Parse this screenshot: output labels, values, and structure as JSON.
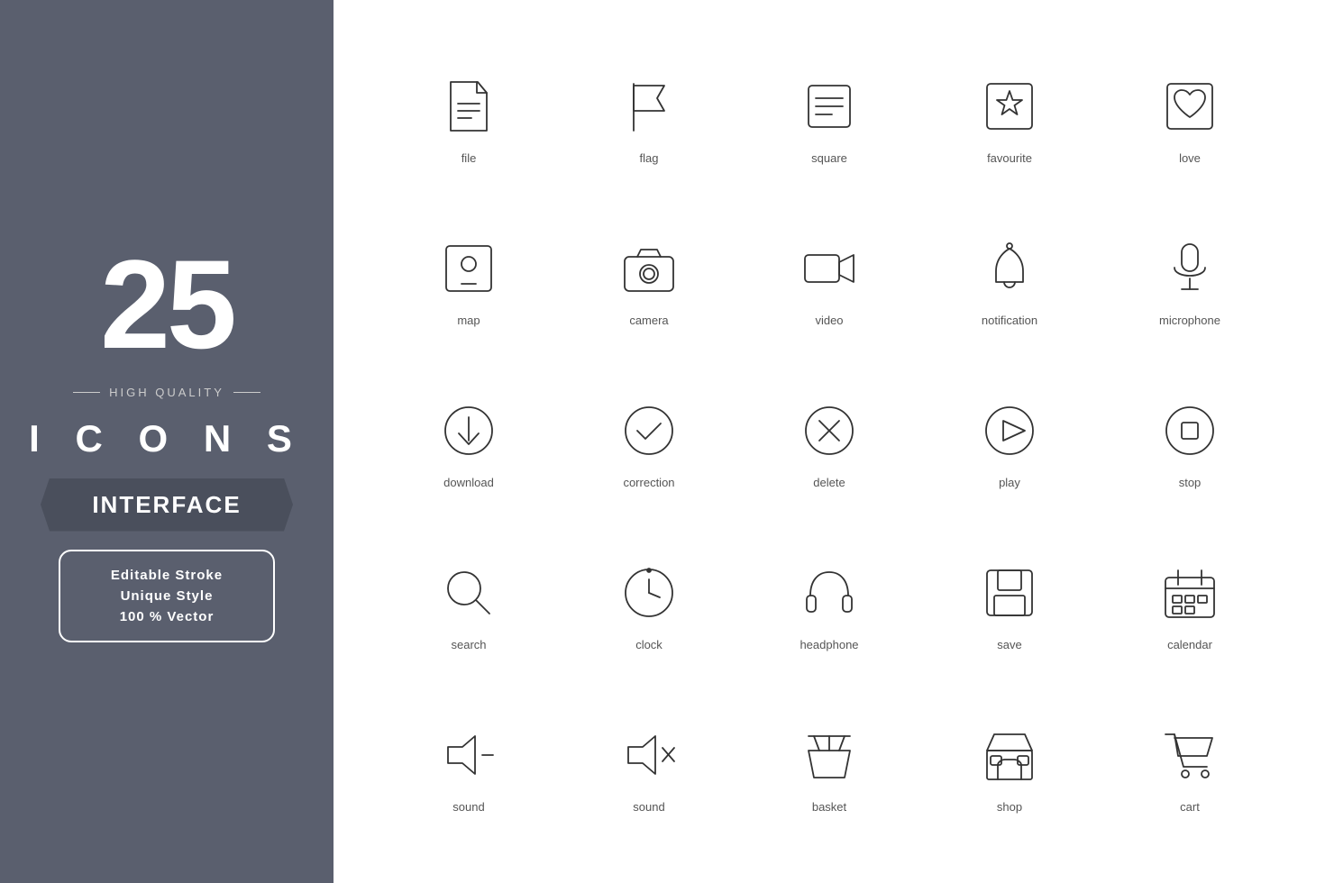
{
  "left": {
    "number": "25",
    "hq_label": "HIGH QUALITY",
    "icons_label": "I C O N S",
    "banner_label": "INTERFACE",
    "features": [
      "Editable Stroke",
      "Unique Style",
      "100 % Vector"
    ]
  },
  "icons": [
    {
      "name": "file",
      "label": "file"
    },
    {
      "name": "flag",
      "label": "flag"
    },
    {
      "name": "square",
      "label": "square"
    },
    {
      "name": "favourite",
      "label": "favourite"
    },
    {
      "name": "love",
      "label": "love"
    },
    {
      "name": "map",
      "label": "map"
    },
    {
      "name": "camera",
      "label": "camera"
    },
    {
      "name": "video",
      "label": "video"
    },
    {
      "name": "notification",
      "label": "notification"
    },
    {
      "name": "microphone",
      "label": "microphone"
    },
    {
      "name": "download",
      "label": "download"
    },
    {
      "name": "correction",
      "label": "correction"
    },
    {
      "name": "delete",
      "label": "delete"
    },
    {
      "name": "play",
      "label": "play"
    },
    {
      "name": "stop",
      "label": "stop"
    },
    {
      "name": "search",
      "label": "search"
    },
    {
      "name": "clock",
      "label": "clock"
    },
    {
      "name": "headphone",
      "label": "headphone"
    },
    {
      "name": "save",
      "label": "save"
    },
    {
      "name": "calendar",
      "label": "calendar"
    },
    {
      "name": "sound-minus",
      "label": "sound"
    },
    {
      "name": "sound-mute",
      "label": "sound"
    },
    {
      "name": "basket",
      "label": "basket"
    },
    {
      "name": "shop",
      "label": "shop"
    },
    {
      "name": "cart",
      "label": "cart"
    }
  ]
}
